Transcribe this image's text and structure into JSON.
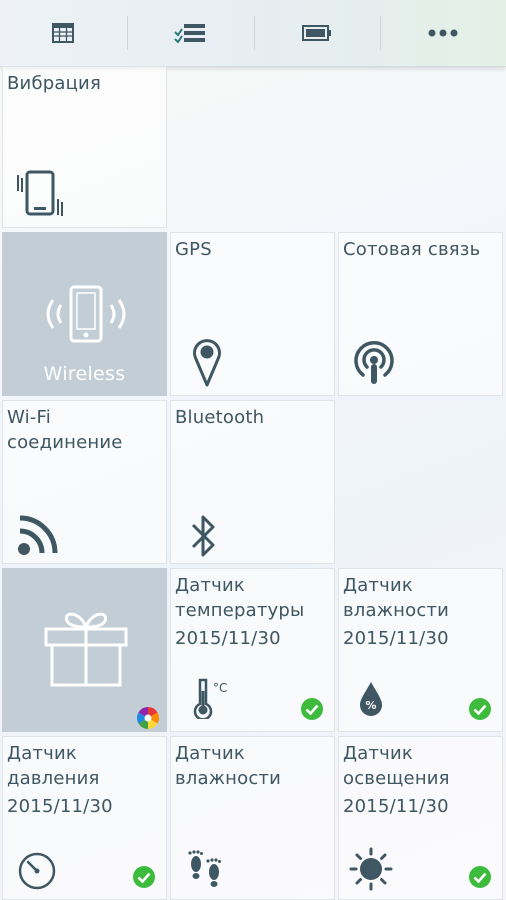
{
  "toolbar": {
    "tabs": [
      {
        "icon": "calendar-grid-icon"
      },
      {
        "icon": "checklist-icon"
      },
      {
        "icon": "battery-icon"
      },
      {
        "icon": "more-dots-icon"
      }
    ]
  },
  "tiles": {
    "vibration": {
      "label": "Вибрация",
      "icon": "phone-vibrate-icon"
    },
    "wireless": {
      "label": "Wireless",
      "icon": "phone-wireless-icon"
    },
    "gps": {
      "label": "GPS",
      "icon": "location-pin-icon"
    },
    "cellular": {
      "label": "Сотовая связь",
      "icon": "antenna-icon"
    },
    "wifi": {
      "label_line1": "Wi-Fi",
      "label_line2": "соединение",
      "icon": "wifi-icon"
    },
    "bluetooth": {
      "label": "Bluetooth",
      "icon": "bluetooth-icon"
    },
    "gift": {
      "icon": "gift-icon"
    },
    "temp_sensor": {
      "label_line1": "Датчик",
      "label_line2": "температуры",
      "date": "2015/11/30",
      "icon": "thermometer-icon",
      "unit": "°C"
    },
    "humidity_sensor": {
      "label_line1": "Датчик",
      "label_line2": "влажности",
      "date": "2015/11/30",
      "icon": "humidity-drop-icon",
      "unit": "%"
    },
    "pressure_sensor": {
      "label_line1": "Датчик",
      "label_line2": "давления",
      "date": "2015/11/30",
      "icon": "gauge-icon"
    },
    "pedometer": {
      "label_line1": "Датчик",
      "label_line2": "влажности",
      "icon": "footprints-icon"
    },
    "light_sensor": {
      "label_line1": "Датчик",
      "label_line2": "освещения",
      "date": "2015/11/30",
      "icon": "sun-icon"
    }
  },
  "colors": {
    "icon": "#3f5663",
    "check": "#3dbb3d",
    "tile_dark": "#c3cdd5",
    "text": "#3f5663"
  }
}
